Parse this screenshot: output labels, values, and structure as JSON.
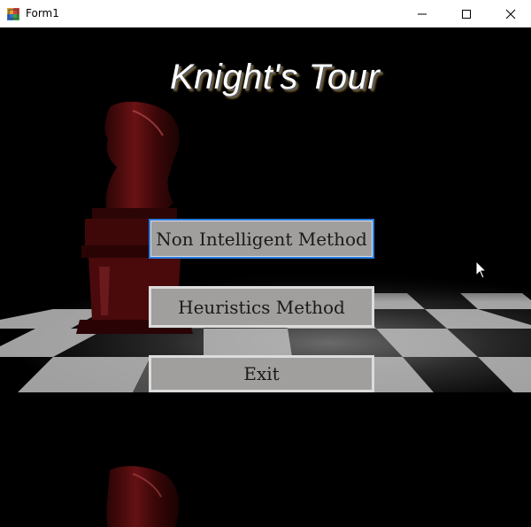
{
  "window": {
    "title": "Form1",
    "icon": "winforms-app-icon",
    "controls": [
      "minimize-icon",
      "maximize-icon",
      "close-icon"
    ]
  },
  "main": {
    "game_title": "Knight's Tour",
    "buttons": [
      {
        "label": "Non Intelligent Method",
        "focused": true
      },
      {
        "label": "Heuristics Method",
        "focused": false
      },
      {
        "label": "Exit",
        "focused": false
      }
    ]
  },
  "colors": {
    "button_face": "#a09f9e",
    "button_border": "#dcdcdc",
    "focus_border": "#2a7de0",
    "background": "#000000",
    "knight_piece": "#5a0f10"
  }
}
